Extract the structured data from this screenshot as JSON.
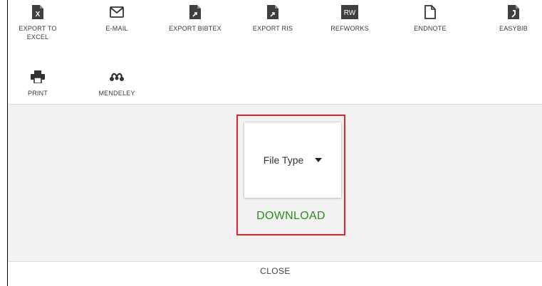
{
  "toolbar": {
    "items": [
      {
        "label_line1": "EXPORT TO",
        "label_line2": "EXCEL",
        "icon": "excel-file-icon"
      },
      {
        "label": "E-MAIL",
        "icon": "envelope-icon"
      },
      {
        "label": "EXPORT BIBTEX",
        "icon": "file-export-icon"
      },
      {
        "label": "EXPORT RIS",
        "icon": "file-export-icon"
      },
      {
        "label": "REFWORKS",
        "icon": "refworks-icon",
        "icon_text": "RW"
      },
      {
        "label": "ENDNOTE",
        "icon": "document-outline-icon"
      },
      {
        "label": "EASYBIB",
        "icon": "easybib-icon"
      },
      {
        "label": "PRINT",
        "icon": "printer-icon"
      },
      {
        "label": "MENDELEY",
        "icon": "mendeley-icon"
      }
    ]
  },
  "download_panel": {
    "file_type_label": "File Type",
    "download_label": "DOWNLOAD",
    "highlight_color": "#e3232b",
    "download_color": "#2e8b20"
  },
  "footer": {
    "close_label": "CLOSE"
  }
}
